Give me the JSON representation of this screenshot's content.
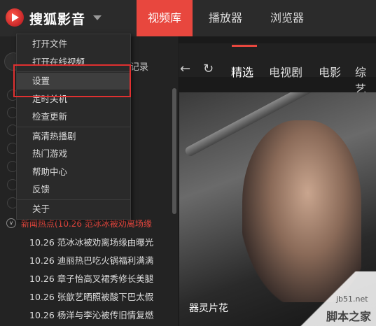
{
  "app": {
    "title": "搜狐影音"
  },
  "nav": {
    "tabs": [
      {
        "label": "视频库",
        "active": true
      },
      {
        "label": "播放器",
        "active": false
      },
      {
        "label": "浏览器",
        "active": false
      }
    ],
    "accent_color": "#e8473e"
  },
  "menu": {
    "items": [
      "打开文件",
      "打开在线视频",
      "设置",
      "定时关机",
      "检查更新",
      "高清热播剧",
      "热门游戏",
      "帮助中心",
      "反馈",
      "关于"
    ]
  },
  "sidebar": {
    "record_label": "记录",
    "news_header": "新闻热点(10.26 范冰冰被劝离场缘",
    "news_items": [
      "10.26 范冰冰被劝离场缘由曝光",
      "10.26 迪丽热巴吃火锅福利满满",
      "10.26 章子怡高叉裙秀修长美腿",
      "10.26 张歆艺晒照被酸下巴太假",
      "10.26 杨洋与李沁被传旧情复燃"
    ]
  },
  "main": {
    "subtabs": [
      "精选",
      "电视剧",
      "电影",
      "综艺"
    ],
    "hero_caption": "器灵片花"
  },
  "watermark": {
    "url": "jb51.net",
    "text": "脚本之家"
  }
}
